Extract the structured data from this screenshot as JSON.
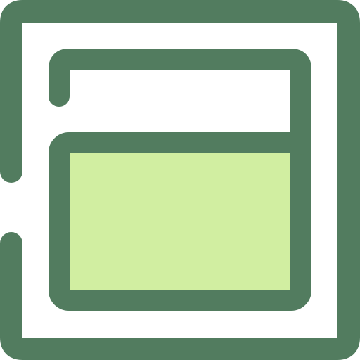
{
  "icon": {
    "name": "window-layout-icon",
    "colors": {
      "stroke": "#527c5f",
      "fill": "#d1eea1",
      "background": "#ffffff"
    }
  }
}
